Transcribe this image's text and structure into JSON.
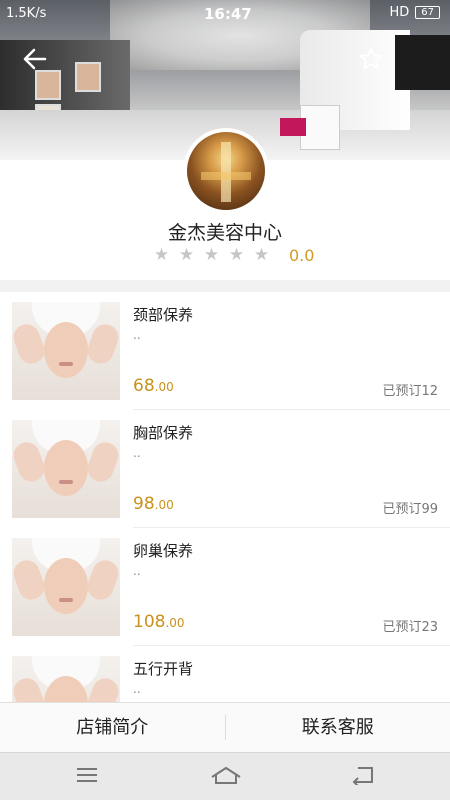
{
  "statusbar": {
    "network": "1.5K/s",
    "time": "16:47",
    "hd": "HD",
    "battery": "67"
  },
  "header": {
    "back_icon": "back-arrow-icon",
    "favorite_icon": "star-outline-icon"
  },
  "shop": {
    "name": "金杰美容中心",
    "stars": [
      "★",
      "★",
      "★",
      "★",
      "★"
    ],
    "star_color": "#c6c6c6",
    "score": "0.0"
  },
  "services": [
    {
      "title": "颈部保养",
      "desc": "..",
      "price_int": "68",
      "price_dec": ".00",
      "booked": "已预订12"
    },
    {
      "title": "胸部保养",
      "desc": "..",
      "price_int": "98",
      "price_dec": ".00",
      "booked": "已预订99"
    },
    {
      "title": "卵巢保养",
      "desc": "..",
      "price_int": "108",
      "price_dec": ".00",
      "booked": "已预订23"
    },
    {
      "title": "五行开背",
      "desc": "..",
      "price_int": "",
      "price_dec": "",
      "booked": ""
    }
  ],
  "actions": {
    "intro": "店铺简介",
    "contact": "联系客服"
  },
  "colors": {
    "accent": "#c9921d",
    "star_gray": "#c6c6c6"
  },
  "sysnav": {
    "menu": "≡",
    "home": "⌂",
    "back": "↩"
  }
}
